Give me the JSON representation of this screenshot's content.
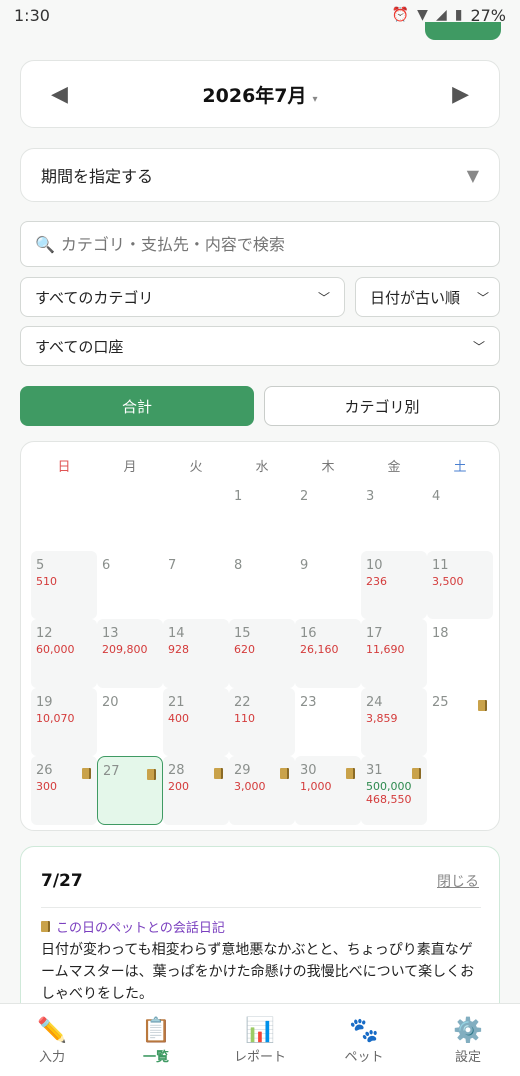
{
  "status_bar": {
    "time": "1:30",
    "battery": "27%"
  },
  "header": {
    "title_fragment": ""
  },
  "month_nav": {
    "prev": "◀",
    "title": "2026年7月",
    "caret": "▾",
    "next": "▶"
  },
  "period": {
    "label": "期間を指定する",
    "arrow": "▼"
  },
  "search": {
    "placeholder": "カテゴリ・支払先・内容で検索"
  },
  "filters": {
    "category": "すべてのカテゴリ",
    "sort": "日付が古い順",
    "account": "すべての口座"
  },
  "view_toggle": {
    "total": "合計",
    "by_category": "カテゴリ別"
  },
  "calendar": {
    "weekdays": [
      "日",
      "月",
      "火",
      "水",
      "木",
      "金",
      "土"
    ],
    "weeks": [
      [
        {
          "day": ""
        },
        {
          "day": ""
        },
        {
          "day": ""
        },
        {
          "day": "1"
        },
        {
          "day": "2"
        },
        {
          "day": "3"
        },
        {
          "day": "4"
        }
      ],
      [
        {
          "day": "5",
          "expense": "510"
        },
        {
          "day": "6"
        },
        {
          "day": "7"
        },
        {
          "day": "8"
        },
        {
          "day": "9"
        },
        {
          "day": "10",
          "expense": "236"
        },
        {
          "day": "11",
          "expense": "3,500"
        }
      ],
      [
        {
          "day": "12",
          "expense": "60,000"
        },
        {
          "day": "13",
          "expense": "209,800"
        },
        {
          "day": "14",
          "expense": "928"
        },
        {
          "day": "15",
          "expense": "620"
        },
        {
          "day": "16",
          "expense": "26,160"
        },
        {
          "day": "17",
          "expense": "11,690"
        },
        {
          "day": "18"
        }
      ],
      [
        {
          "day": "19",
          "expense": "10,070"
        },
        {
          "day": "20"
        },
        {
          "day": "21",
          "expense": "400"
        },
        {
          "day": "22",
          "expense": "110"
        },
        {
          "day": "23"
        },
        {
          "day": "24",
          "expense": "3,859"
        },
        {
          "day": "25",
          "diary": true
        }
      ],
      [
        {
          "day": "26",
          "expense": "300",
          "diary": true
        },
        {
          "day": "27",
          "diary": true,
          "selected": true
        },
        {
          "day": "28",
          "expense": "200",
          "diary": true
        },
        {
          "day": "29",
          "expense": "3,000",
          "diary": true
        },
        {
          "day": "30",
          "expense": "1,000",
          "diary": true
        },
        {
          "day": "31",
          "income": "500,000",
          "expense": "468,550",
          "diary": true
        },
        {
          "day": ""
        }
      ]
    ]
  },
  "detail": {
    "date": "7/27",
    "close": "閉じる",
    "diary_title": "この日のペットとの会話日記",
    "diary_body": "日付が変わっても相変わらず意地悪なかぶとと、ちょっぴり素直なゲームマスターは、葉っぱをかけた命懸けの我慢比べについて楽しくおしゃべりをした。"
  },
  "bottom_nav": [
    {
      "label": "入力",
      "icon": "pencil-icon",
      "glyph": "✏️",
      "active": false
    },
    {
      "label": "一覧",
      "icon": "clipboard-icon",
      "glyph": "📋",
      "active": true
    },
    {
      "label": "レポート",
      "icon": "chart-icon",
      "glyph": "📊",
      "active": false
    },
    {
      "label": "ペット",
      "icon": "paw-icon",
      "glyph": "🐾",
      "active": false
    },
    {
      "label": "設定",
      "icon": "gear-icon",
      "glyph": "⚙️",
      "active": false
    }
  ]
}
